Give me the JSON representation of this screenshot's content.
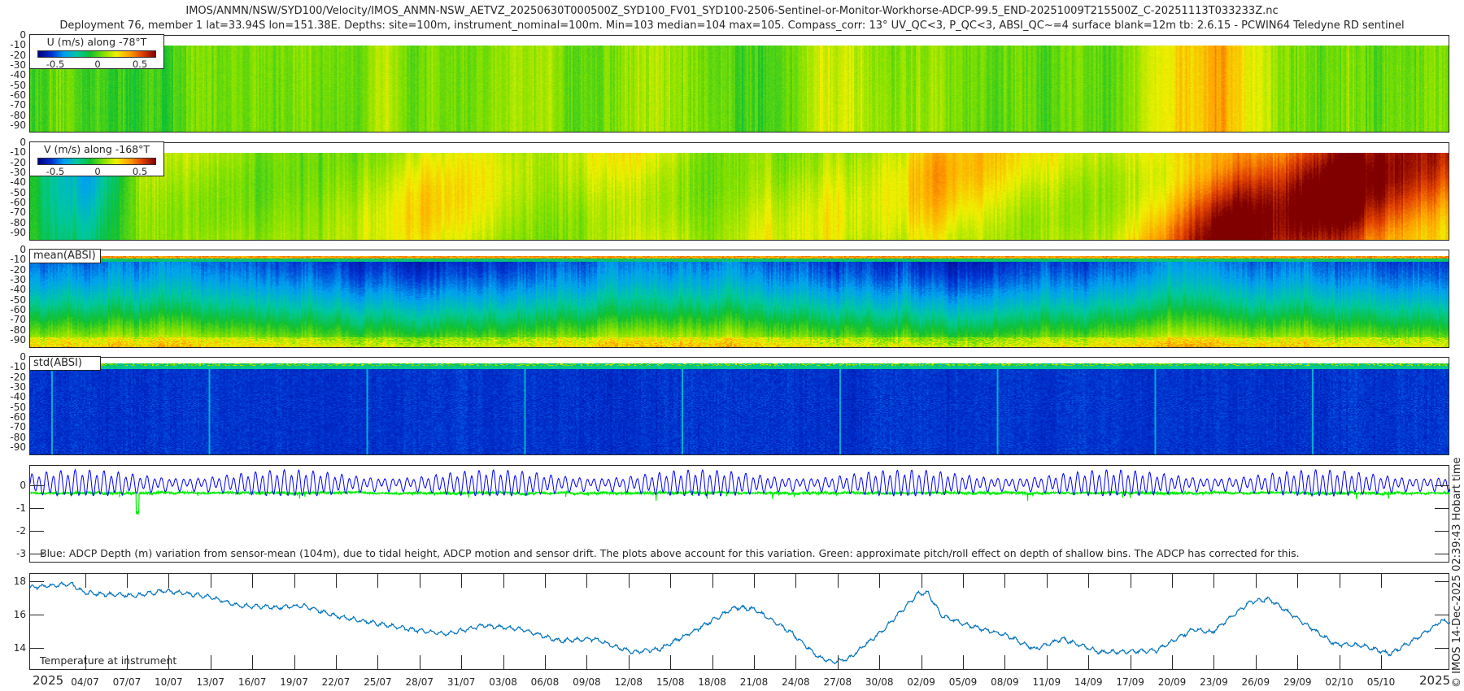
{
  "header": {
    "line1": "IMOS/ANMN/NSW/SYD100/Velocity/IMOS_ANMN-NSW_AETVZ_20250630T000500Z_SYD100_FV01_SYD100-2506-Sentinel-or-Monitor-Workhorse-ADCP-99.5_END-20251009T215500Z_C-20251113T033233Z.nc",
    "line2": "Deployment 76, member 1 lat=33.94S lon=151.38E. Depths: site=100m, instrument_nominal=100m. Min=103 median=104 max=105. Compass_corr: 13° UV_QC<3, P_QC<3, ABSI_QC~=4 surface blank=12m tb: 2.6.15 - PCWIN64 Teledyne RD sentinel"
  },
  "side_label": "© IMOS 14-Dec-2025 02:39:43 Hobart time",
  "colors": {
    "axis": "#262626",
    "depth_line": "#0000ff",
    "pitch_roll_line": "#00ee00",
    "temperature_line": "#0072bd",
    "colormap": [
      "#00007f",
      "#0030d0",
      "#00a0f0",
      "#00c8a0",
      "#10c030",
      "#80e000",
      "#f0f000",
      "#ffa000",
      "#e04000",
      "#800000"
    ]
  },
  "year_labels": [
    "2025",
    "2025"
  ],
  "chart_data": [
    {
      "type": "heatmap",
      "id": "u",
      "legend_title": "U (m/s) along -78°T",
      "colorbar_ticks": [
        {
          "label": "-0.5",
          "value": -0.5
        },
        {
          "label": "0",
          "value": 0
        },
        {
          "label": "0.5",
          "value": 0.5
        }
      ],
      "clim": [
        -0.7,
        0.7
      ],
      "ylim": [
        0,
        -98
      ],
      "yticks": [
        "0",
        "-10",
        "-20",
        "-30",
        "-40",
        "-50",
        "-60",
        "-70",
        "-80",
        "-90"
      ],
      "xlim_days": [
        0,
        101.9
      ],
      "blank_above_m": 9,
      "coarse_depth_mean_values": [
        0,
        0,
        -0.05,
        0.05,
        0.1,
        0.05,
        0.1,
        0.1,
        0.05,
        0.1,
        0.05,
        0.15,
        0.05,
        0,
        0.2,
        0.05,
        0.1,
        0,
        0.05,
        0.05,
        0.25,
        0.35,
        0.1,
        0.05,
        0.05,
        0.05
      ]
    },
    {
      "type": "heatmap",
      "id": "v",
      "legend_title": "V (m/s) along -168°T",
      "colorbar_ticks": [
        {
          "label": "-0.5",
          "value": -0.5
        },
        {
          "label": "0",
          "value": 0
        },
        {
          "label": "0.5",
          "value": 0.5
        }
      ],
      "clim": [
        -0.7,
        0.7
      ],
      "ylim": [
        0,
        -98
      ],
      "yticks": [
        "0",
        "-10",
        "-20",
        "-30",
        "-40",
        "-50",
        "-60",
        "-70",
        "-80",
        "-90"
      ],
      "xlim_days": [
        0,
        101.9
      ],
      "blank_above_m": 9,
      "coarse_depth_mean_values": [
        -0.05,
        -0.35,
        0.1,
        0.2,
        0.15,
        0.1,
        0.2,
        0.3,
        0.2,
        0.1,
        0.2,
        0.25,
        0.1,
        0.2,
        0.2,
        0.15,
        0.35,
        0.3,
        0.25,
        0.2,
        0.45,
        0.7,
        0.55,
        0.7,
        0.6,
        0.55
      ]
    },
    {
      "type": "heatmap",
      "id": "mean_absi",
      "legend_title": "mean(ABSI)",
      "ylim": [
        0,
        -98
      ],
      "yticks": [
        "0",
        "-10",
        "-20",
        "-30",
        "-40",
        "-50",
        "-60",
        "-70",
        "-80",
        "-90"
      ],
      "xlim_days": [
        0,
        101.9
      ],
      "blank_above_m": 5
    },
    {
      "type": "heatmap",
      "id": "std_absi",
      "legend_title": "std(ABSI)",
      "ylim": [
        0,
        -98
      ],
      "yticks": [
        "0",
        "-10",
        "-20",
        "-30",
        "-40",
        "-50",
        "-60",
        "-70",
        "-80",
        "-90"
      ],
      "xlim_days": [
        0,
        101.9
      ],
      "blank_above_m": 5
    },
    {
      "type": "line",
      "id": "depth_variation",
      "caption": "Blue: ADCP Depth (m) variation from sensor-mean (104m), due to tidal height, ADCP motion and sensor drift. The plots above account for this variation. Green: approximate pitch/roll effect on depth of shallow bins. The ADCP has corrected for this.",
      "ylim": [
        -3.4,
        0.9
      ],
      "yticks": [
        {
          "label": "0",
          "value": 0
        },
        {
          "label": "-1",
          "value": -1
        },
        {
          "label": "-2",
          "value": -2
        },
        {
          "label": "-3",
          "value": -3
        }
      ],
      "series": [
        {
          "name": "ADCP depth variation",
          "mean": 0.1,
          "tidal_amplitude_m": [
            0.2,
            0.5
          ],
          "semidiurnal_period_days": 0.5175,
          "spring_neap_days": 14.8
        },
        {
          "name": "pitch/roll effect",
          "mean": -0.3,
          "min": -1.25
        }
      ]
    },
    {
      "type": "line",
      "id": "temperature",
      "caption": "Temperature at instrument",
      "ylim": [
        12.7,
        18.5
      ],
      "yticks": [
        {
          "label": "18",
          "value": 18
        },
        {
          "label": "16",
          "value": 16
        },
        {
          "label": "14",
          "value": 14
        }
      ],
      "x_days": [
        0,
        1.6,
        3,
        3.8,
        5,
        7.6,
        9.7,
        13,
        15,
        17.7,
        19.7,
        21.8,
        24.4,
        27.1,
        29.8,
        32.5,
        35.2,
        37.9,
        40.5,
        43.2,
        45.2,
        47.9,
        50.6,
        51.9,
        54.6,
        56.6,
        57.6,
        58.7,
        61.3,
        63.7,
        64.4,
        65.4,
        67.4,
        70.1,
        72.1,
        74.1,
        76.8,
        80.8,
        83.5,
        84.8,
        87.5,
        88.9,
        91.5,
        93.6,
        95.6,
        97.6,
        99.6,
        101.3,
        101.9
      ],
      "y": [
        17.7,
        17.8,
        17.9,
        17.4,
        17.3,
        17.2,
        17.5,
        17.1,
        16.6,
        16.5,
        16.6,
        16.0,
        15.6,
        15.2,
        14.9,
        15.4,
        15.2,
        14.5,
        14.6,
        13.8,
        14.0,
        15.2,
        16.5,
        16.4,
        15.0,
        13.5,
        13.2,
        13.4,
        15.2,
        17.3,
        17.4,
        16.0,
        15.4,
        14.8,
        14.0,
        14.6,
        13.8,
        13.9,
        15.2,
        15.0,
        16.8,
        17.0,
        15.5,
        14.3,
        14.2,
        13.7,
        14.7,
        15.7,
        15.6
      ]
    }
  ],
  "xticks": [
    {
      "label": "04/07",
      "day": 4
    },
    {
      "label": "07/07",
      "day": 7
    },
    {
      "label": "10/07",
      "day": 10
    },
    {
      "label": "13/07",
      "day": 13
    },
    {
      "label": "16/07",
      "day": 16
    },
    {
      "label": "19/07",
      "day": 19
    },
    {
      "label": "22/07",
      "day": 22
    },
    {
      "label": "25/07",
      "day": 25
    },
    {
      "label": "28/07",
      "day": 28
    },
    {
      "label": "31/07",
      "day": 31
    },
    {
      "label": "03/08",
      "day": 34
    },
    {
      "label": "06/08",
      "day": 37
    },
    {
      "label": "09/08",
      "day": 40
    },
    {
      "label": "12/08",
      "day": 43
    },
    {
      "label": "15/08",
      "day": 46
    },
    {
      "label": "18/08",
      "day": 49
    },
    {
      "label": "21/08",
      "day": 52
    },
    {
      "label": "24/08",
      "day": 55
    },
    {
      "label": "27/08",
      "day": 58
    },
    {
      "label": "30/08",
      "day": 61
    },
    {
      "label": "02/09",
      "day": 64
    },
    {
      "label": "05/09",
      "day": 67
    },
    {
      "label": "08/09",
      "day": 70
    },
    {
      "label": "11/09",
      "day": 73
    },
    {
      "label": "14/09",
      "day": 76
    },
    {
      "label": "17/09",
      "day": 79
    },
    {
      "label": "20/09",
      "day": 82
    },
    {
      "label": "23/09",
      "day": 85
    },
    {
      "label": "26/09",
      "day": 88
    },
    {
      "label": "29/09",
      "day": 91
    },
    {
      "label": "02/10",
      "day": 94
    },
    {
      "label": "05/10",
      "day": 97
    }
  ]
}
